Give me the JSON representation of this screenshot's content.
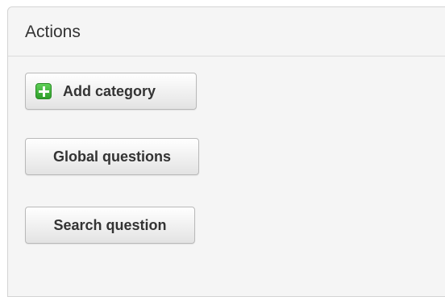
{
  "panel": {
    "title": "Actions",
    "buttons": {
      "add_category": {
        "label": "Add category",
        "icon": "plus-icon"
      },
      "global_questions": {
        "label": "Global questions"
      },
      "search_question": {
        "label": "Search question"
      }
    }
  },
  "colors": {
    "panel_background": "#f5f5f5",
    "plus_icon_green": "#3cb035"
  }
}
